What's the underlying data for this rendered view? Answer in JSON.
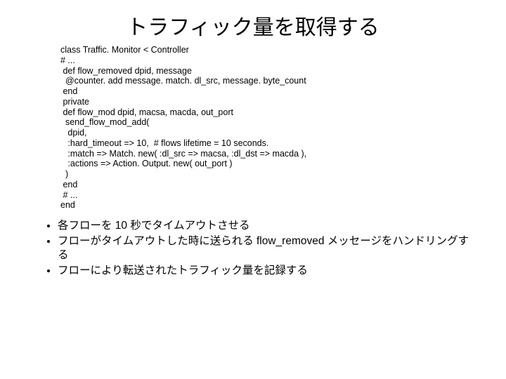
{
  "title": "トラフィック量を取得する",
  "code": {
    "l01": "class Traffic. Monitor < Controller",
    "l02": "# ...",
    "l03": " def flow_removed dpid, message",
    "l04": "  @counter. add message. match. dl_src, message. byte_count",
    "l05": " end",
    "l06": " private",
    "l07": " def flow_mod dpid, macsa, macda, out_port",
    "l08": "  send_flow_mod_add(",
    "l09": "   dpid,",
    "l10": "   :hard_timeout => 10,  # flows lifetime = 10 seconds.",
    "l11": "   :match => Match. new( :dl_src => macsa, :dl_dst => macda ),",
    "l12": "   :actions => Action. Output. new( out_port )",
    "l13": "  )",
    "l14": " end",
    "l15": " # ...",
    "l16": "end"
  },
  "bullets": {
    "b1": "各フローを 10 秒でタイムアウトさせる",
    "b2": "フローがタイムアウトした時に送られる flow_removed メッセージをハンドリングする",
    "b3": "フローにより転送されたトラフィック量を記録する"
  }
}
